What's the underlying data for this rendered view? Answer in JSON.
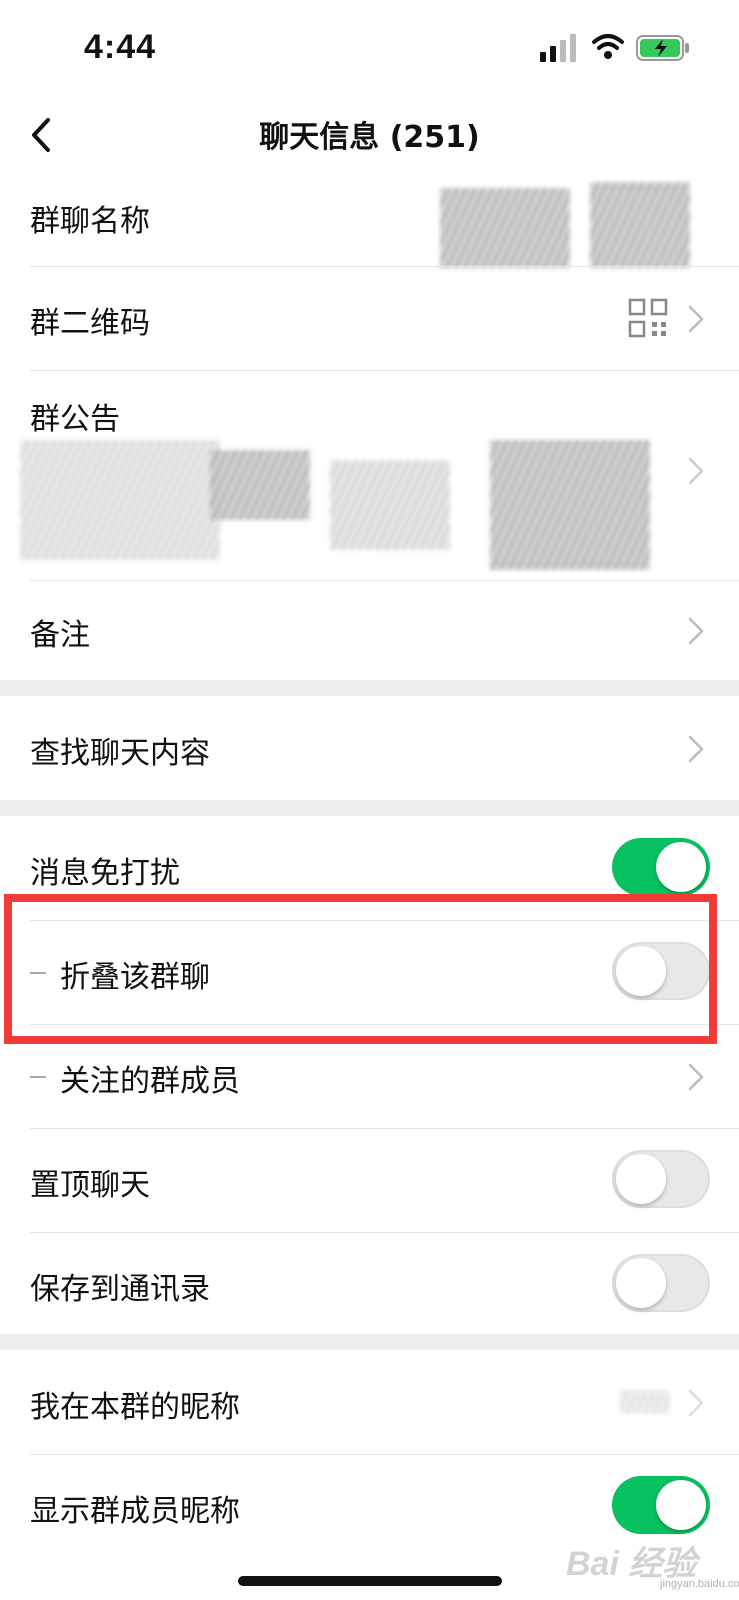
{
  "status_bar": {
    "time": "4:44"
  },
  "header": {
    "title": "聊天信息 (251)"
  },
  "group_info": {
    "name_label": "群聊名称",
    "qrcode_label": "群二维码",
    "announcement_label": "群公告",
    "remark_label": "备注"
  },
  "search": {
    "label": "查找聊天内容"
  },
  "settings": {
    "mute_label": "消息免打扰",
    "mute_on": true,
    "fold_label": "折叠该群聊",
    "fold_on": false,
    "followed_label": "关注的群成员",
    "pin_label": "置顶聊天",
    "pin_on": false,
    "save_label": "保存到通讯录",
    "save_on": false
  },
  "nickname": {
    "my_nickname_label": "我在本群的昵称",
    "show_nickname_label": "显示群成员昵称",
    "show_nickname_on": true
  },
  "watermark": {
    "text": "Bai 经验",
    "sub": "jingyan.baidu.com"
  },
  "colors": {
    "accent_green": "#07c160",
    "highlight_red": "#f23a38"
  }
}
